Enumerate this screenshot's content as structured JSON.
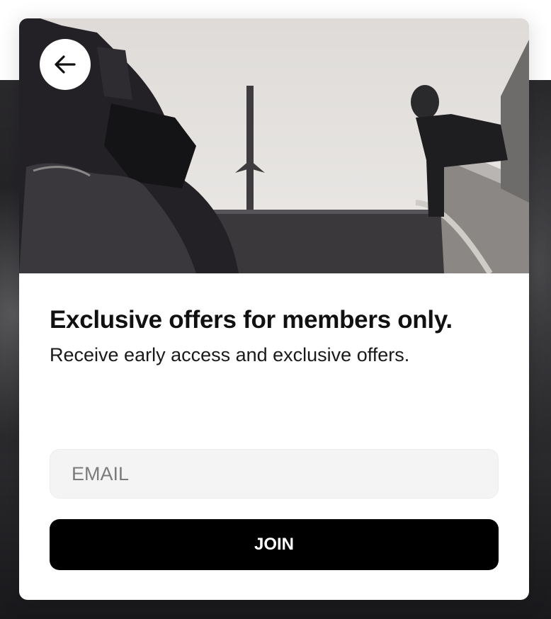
{
  "modal": {
    "back_icon": "arrow-left-icon",
    "hero_image": "black-and-white photo of a photographer and a man on stairs",
    "title": "Exclusive offers for members only.",
    "subtitle": "Receive early access and exclusive offers.",
    "email": {
      "placeholder": "EMAIL",
      "value": ""
    },
    "join_label": "JOIN"
  },
  "colors": {
    "button_bg": "#000000",
    "input_bg": "#f4f4f4",
    "backdrop": "#232225"
  }
}
